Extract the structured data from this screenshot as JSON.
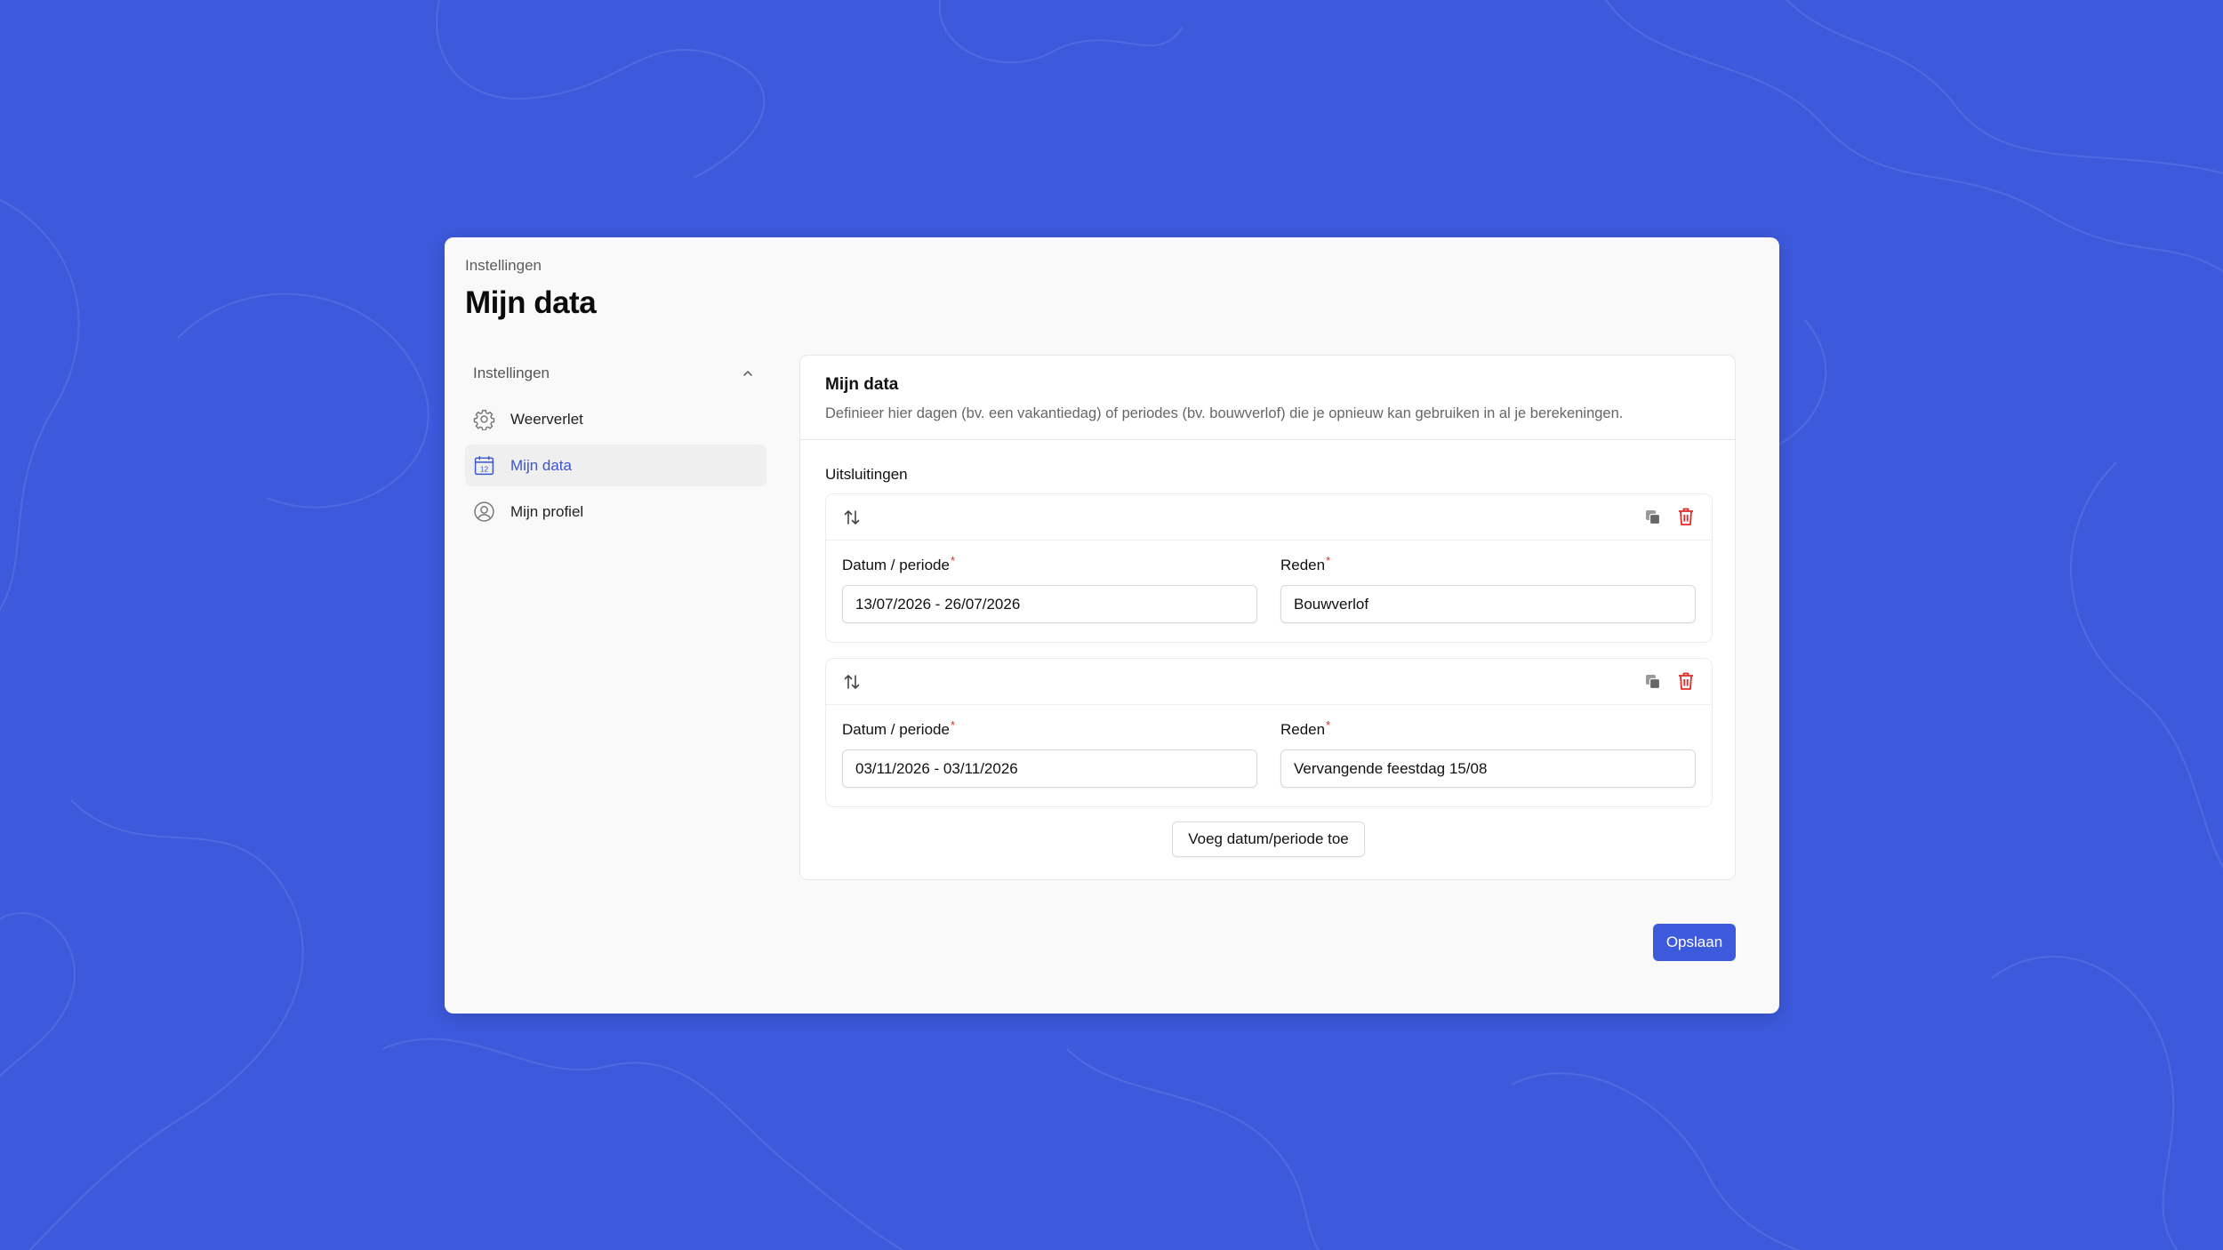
{
  "colors": {
    "background": "#3d5add",
    "accent": "#3b54cf",
    "danger": "#e02a2a"
  },
  "breadcrumb": "Instellingen",
  "page_title": "Mijn data",
  "sidebar": {
    "group_label": "Instellingen",
    "group_icon": "chevron-up-icon",
    "items": [
      {
        "label": "Weerverlet",
        "icon": "gear-icon",
        "active": false
      },
      {
        "label": "Mijn data",
        "icon": "calendar-icon",
        "active": true
      },
      {
        "label": "Mijn profiel",
        "icon": "user-circle-icon",
        "active": false
      }
    ]
  },
  "card": {
    "title": "Mijn data",
    "description": "Definieer hier dagen (bv. een vakantiedag) of periodes (bv. bouwverlof) die je opnieuw kan gebruiken in al je berekeningen.",
    "section_label": "Uitsluitingen",
    "entries": [
      {
        "date_label": "Datum / periode",
        "date_value": "13/07/2026 - 26/07/2026",
        "reason_label": "Reden",
        "reason_value": "Bouwverlof",
        "required_mark": "*"
      },
      {
        "date_label": "Datum / periode",
        "date_value": "03/11/2026 - 03/11/2026",
        "reason_label": "Reden",
        "reason_value": "Vervangende feestdag 15/08",
        "required_mark": "*"
      }
    ],
    "add_button": "Voeg datum/periode toe"
  },
  "save_button": "Opslaan"
}
